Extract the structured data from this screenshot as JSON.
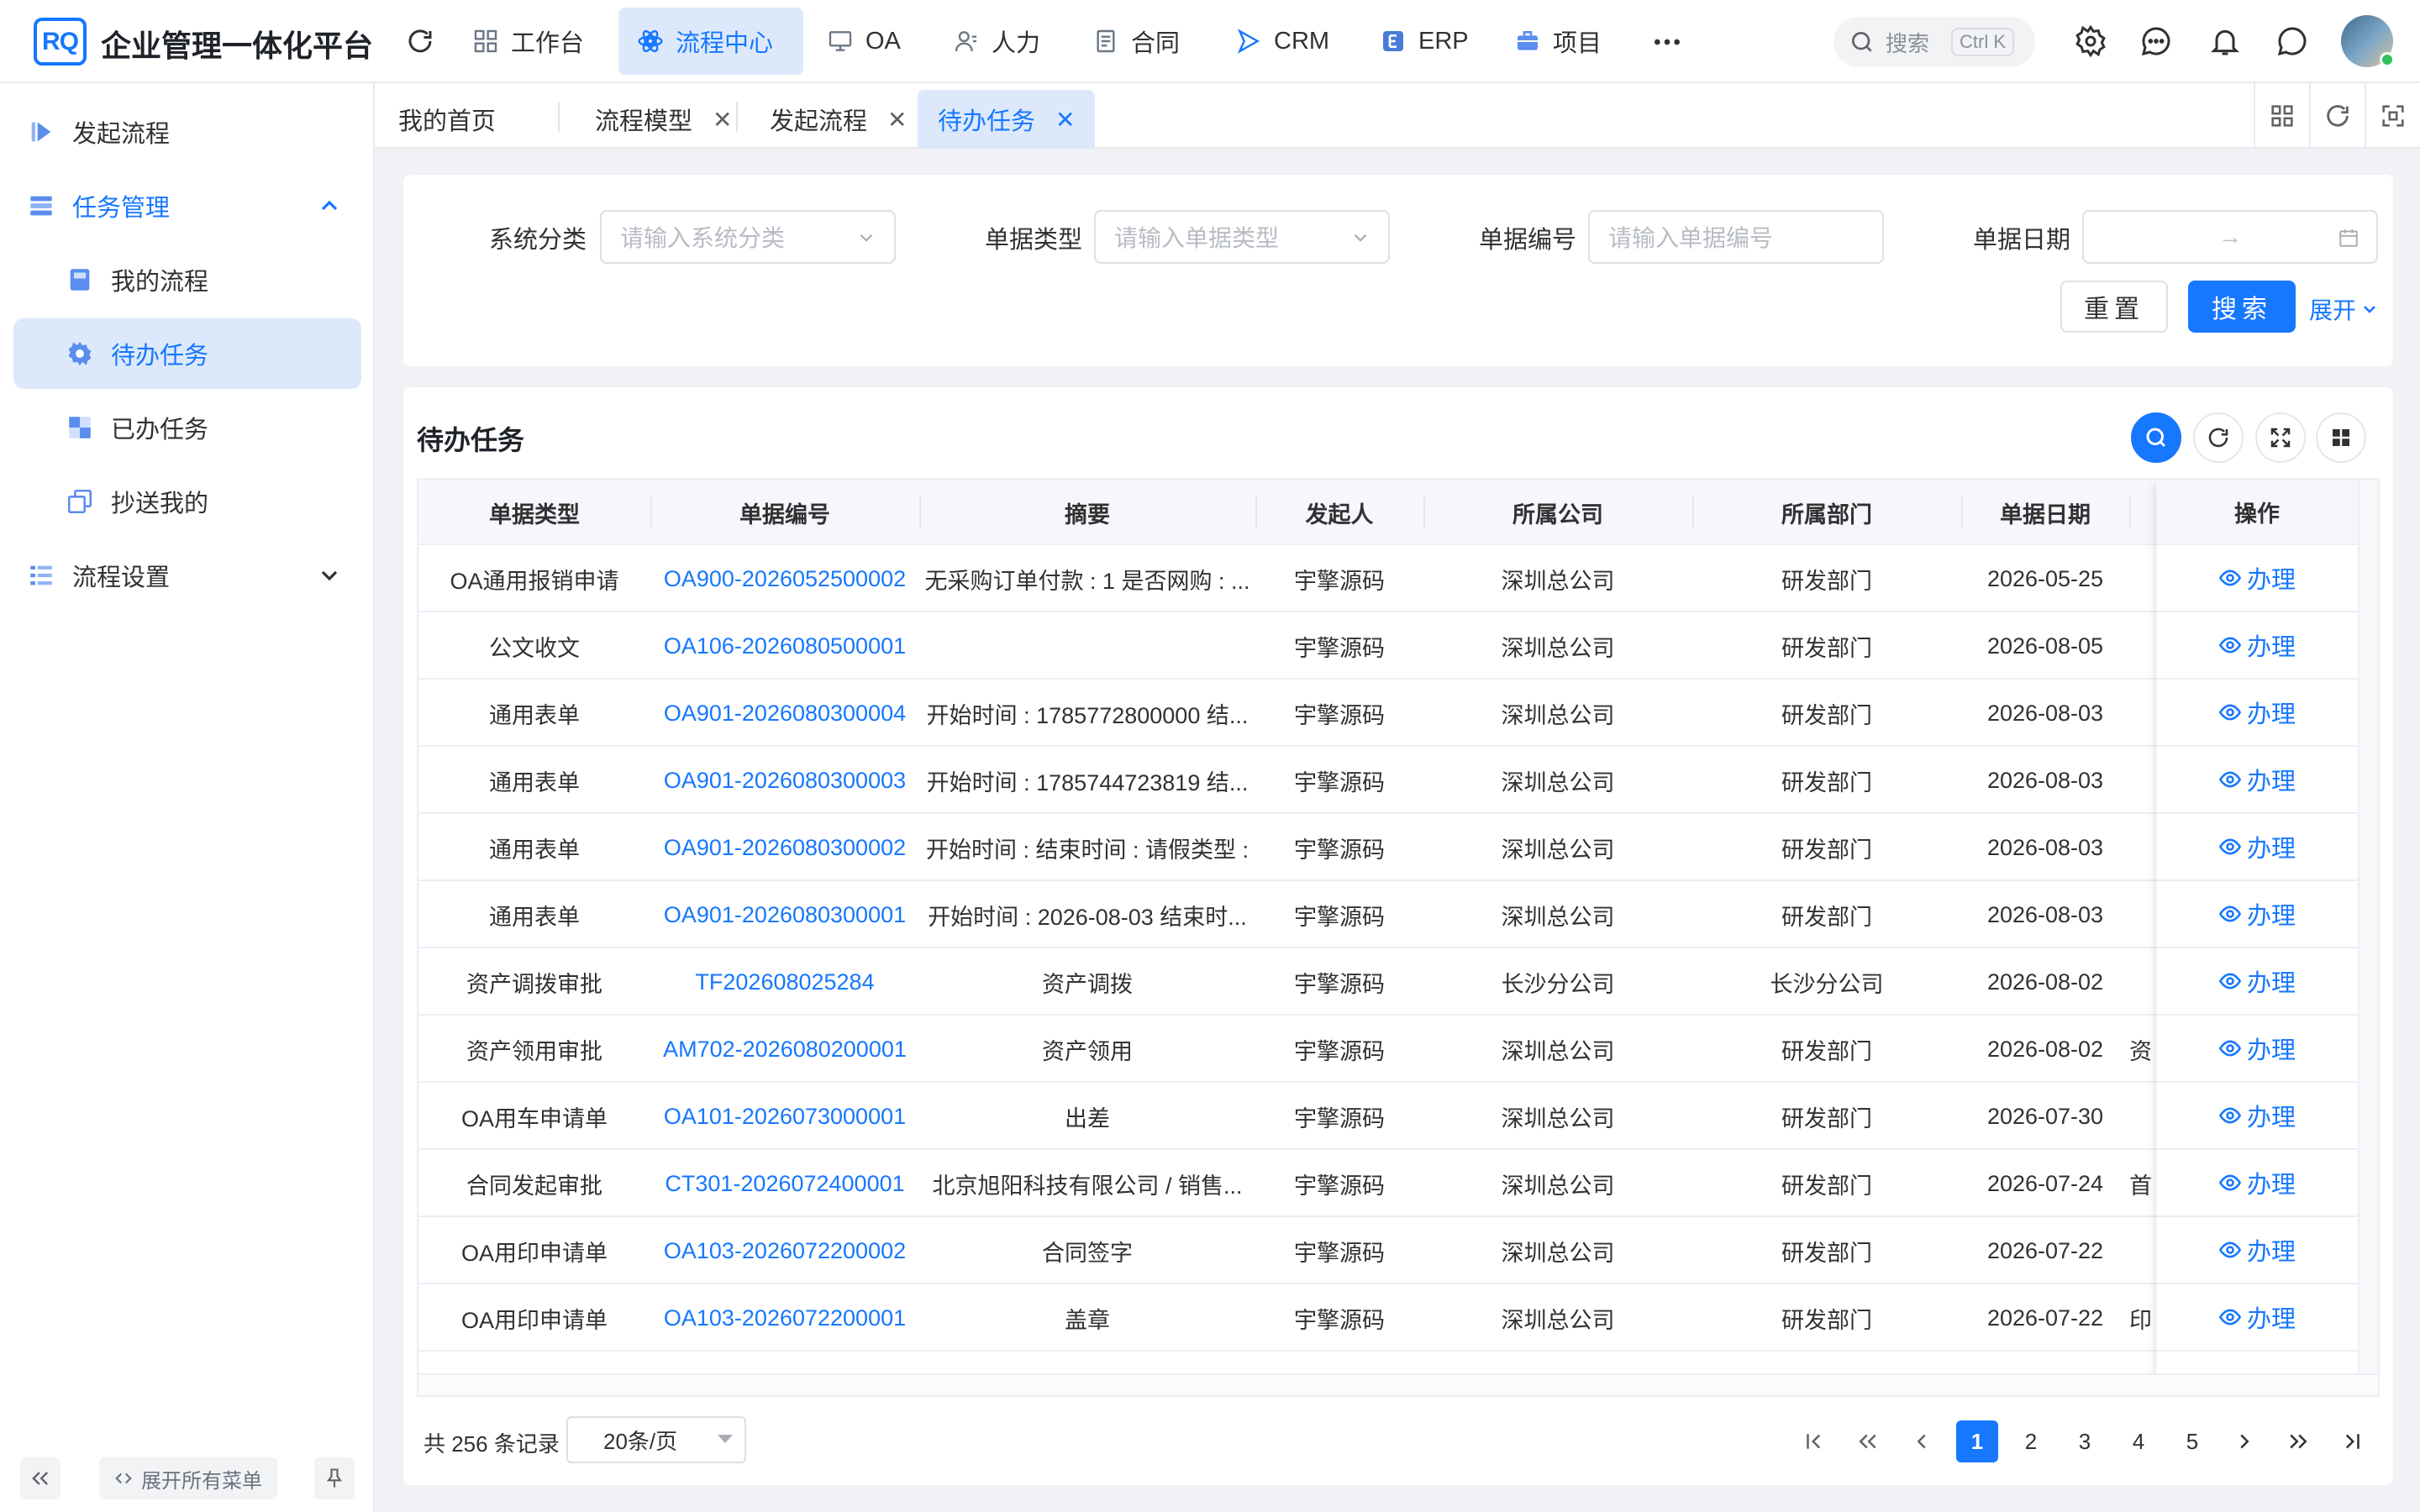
{
  "app": {
    "logo_text": "RQ",
    "title": "企业管理一体化平台"
  },
  "topnav": [
    {
      "label": "工作台",
      "icon": "grid-icon",
      "active": false
    },
    {
      "label": "流程中心",
      "icon": "workflow-icon",
      "active": true
    },
    {
      "label": "OA",
      "icon": "monitor-icon",
      "active": false
    },
    {
      "label": "人力",
      "icon": "user-icon",
      "active": false
    },
    {
      "label": "合同",
      "icon": "document-icon",
      "active": false
    },
    {
      "label": "CRM",
      "icon": "send-icon",
      "active": false
    },
    {
      "label": "ERP",
      "icon": "erp-icon",
      "active": false
    },
    {
      "label": "项目",
      "icon": "briefcase-icon",
      "active": false
    }
  ],
  "search": {
    "placeholder": "搜索",
    "shortcut": "Ctrl K"
  },
  "sidebar": {
    "items": [
      {
        "label": "发起流程",
        "icon": "start-flow-icon"
      },
      {
        "label": "任务管理",
        "icon": "task-list-icon"
      },
      {
        "label": "我的流程",
        "icon": "book-icon"
      },
      {
        "label": "待办任务",
        "icon": "gear-icon"
      },
      {
        "label": "已办任务",
        "icon": "done-icon"
      },
      {
        "label": "抄送我的",
        "icon": "copy-icon"
      },
      {
        "label": "流程设置",
        "icon": "settings-list-icon"
      }
    ],
    "expand_all": "展开所有菜单"
  },
  "tabs": [
    {
      "label": "我的首页",
      "closable": false
    },
    {
      "label": "流程模型",
      "closable": true
    },
    {
      "label": "发起流程",
      "closable": true
    },
    {
      "label": "待办任务",
      "closable": true,
      "active": true
    }
  ],
  "filter": {
    "fields": [
      {
        "label": "系统分类",
        "placeholder": "请输入系统分类",
        "type": "select"
      },
      {
        "label": "单据类型",
        "placeholder": "请输入单据类型",
        "type": "select"
      },
      {
        "label": "单据编号",
        "placeholder": "请输入单据编号",
        "type": "input"
      },
      {
        "label": "单据日期",
        "placeholder": "→",
        "type": "daterange"
      }
    ],
    "reset_label": "重置",
    "search_label": "搜索",
    "expand_label": "展开"
  },
  "table": {
    "title": "待办任务",
    "columns": [
      "单据类型",
      "单据编号",
      "摘要",
      "发起人",
      "所属公司",
      "所属部门",
      "单据日期",
      "",
      "操作"
    ],
    "rows": [
      [
        "OA通用报销申请",
        "OA900-2026052500002",
        "无采购订单付款 : 1 是否网购 : ...",
        "宇擎源码",
        "深圳总公司",
        "研发部门",
        "2026-05-25",
        ""
      ],
      [
        "公文收文",
        "OA106-2026080500001",
        "",
        "宇擎源码",
        "深圳总公司",
        "研发部门",
        "2026-08-05",
        ""
      ],
      [
        "通用表单",
        "OA901-2026080300004",
        "开始时间 : 1785772800000 结...",
        "宇擎源码",
        "深圳总公司",
        "研发部门",
        "2026-08-03",
        ""
      ],
      [
        "通用表单",
        "OA901-2026080300003",
        "开始时间 : 1785744723819 结...",
        "宇擎源码",
        "深圳总公司",
        "研发部门",
        "2026-08-03",
        ""
      ],
      [
        "通用表单",
        "OA901-2026080300002",
        "开始时间 : 结束时间 : 请假类型 :",
        "宇擎源码",
        "深圳总公司",
        "研发部门",
        "2026-08-03",
        ""
      ],
      [
        "通用表单",
        "OA901-2026080300001",
        "开始时间 : 2026-08-03 结束时...",
        "宇擎源码",
        "深圳总公司",
        "研发部门",
        "2026-08-03",
        ""
      ],
      [
        "资产调拨审批",
        "TF202608025284",
        "资产调拨",
        "宇擎源码",
        "长沙分公司",
        "长沙分公司",
        "2026-08-02",
        ""
      ],
      [
        "资产领用审批",
        "AM702-2026080200001",
        "资产领用",
        "宇擎源码",
        "深圳总公司",
        "研发部门",
        "2026-08-02",
        "资"
      ],
      [
        "OA用车申请单",
        "OA101-2026073000001",
        "出差",
        "宇擎源码",
        "深圳总公司",
        "研发部门",
        "2026-07-30",
        ""
      ],
      [
        "合同发起审批",
        "CT301-2026072400001",
        "北京旭阳科技有限公司 / 销售...",
        "宇擎源码",
        "深圳总公司",
        "研发部门",
        "2026-07-24",
        "首"
      ],
      [
        "OA用印申请单",
        "OA103-2026072200002",
        "合同签字",
        "宇擎源码",
        "深圳总公司",
        "研发部门",
        "2026-07-22",
        ""
      ],
      [
        "OA用印申请单",
        "OA103-2026072200001",
        "盖章",
        "宇擎源码",
        "深圳总公司",
        "研发部门",
        "2026-07-22",
        "印"
      ]
    ],
    "action_label": "办理"
  },
  "pager": {
    "total_text": "共 256 条记录",
    "page_size": "20条/页",
    "pages": [
      "1",
      "2",
      "3",
      "4",
      "5"
    ],
    "current": "1"
  },
  "colors": {
    "primary": "#1677ff",
    "active_bg": "#dde9fb"
  }
}
